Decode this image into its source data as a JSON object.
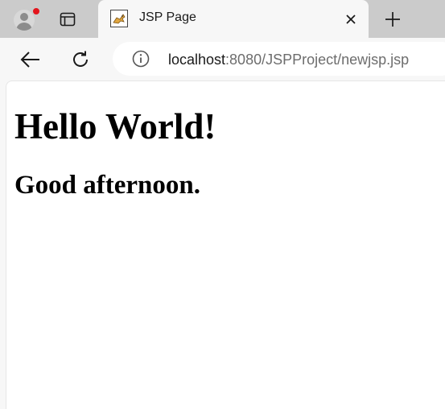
{
  "tab": {
    "title": "JSP Page",
    "favicon": "tomcat-icon"
  },
  "toolbar": {
    "back_icon": "back-arrow-icon",
    "refresh_icon": "refresh-icon"
  },
  "address": {
    "host": "localhost",
    "rest": ":8080/JSPProject/newjsp.jsp",
    "info_icon": "info-icon"
  },
  "page": {
    "heading1": "Hello World!",
    "heading2": "Good afternoon."
  },
  "colors": {
    "tabstrip": "#cbcbcb",
    "toolbar": "#f7f7f7",
    "notification": "#e3141c"
  }
}
